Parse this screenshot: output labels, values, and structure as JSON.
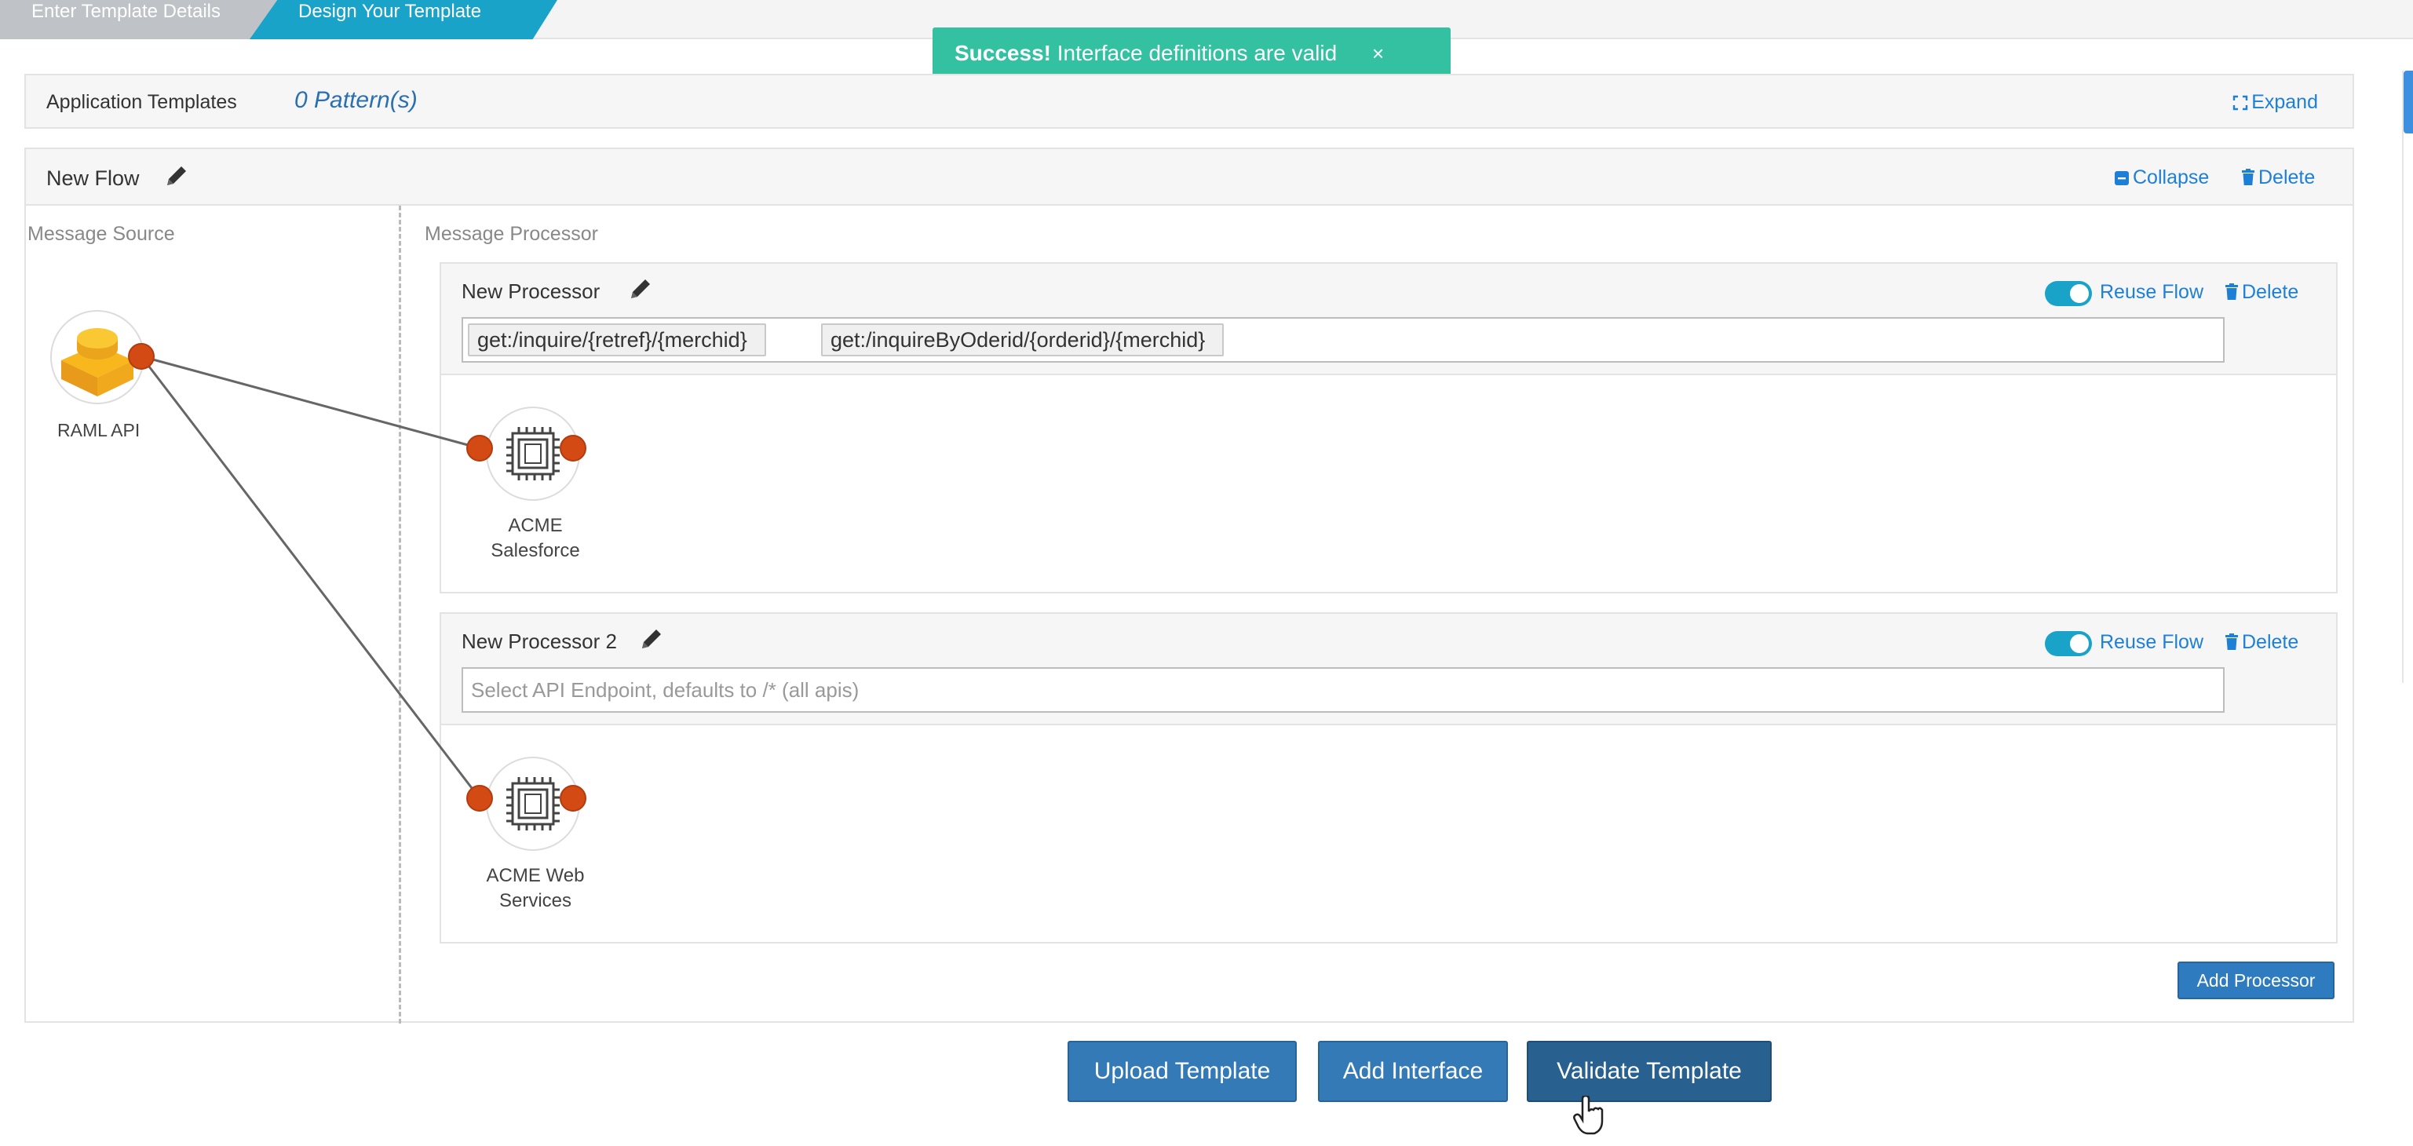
{
  "wizard": {
    "steps": [
      "Enter Template Details",
      "Design Your Template"
    ]
  },
  "toast": {
    "strong": "Success!",
    "message": " Interface definitions are valid",
    "close": "×",
    "color": "#33c1a2"
  },
  "app_templates": {
    "label": "Application Templates",
    "patterns": "0 Pattern(s)",
    "expand": "Expand"
  },
  "flow": {
    "title": "New Flow",
    "collapse": "Collapse",
    "delete": "Delete",
    "source_label": "Message Source",
    "processor_label": "Message Processor",
    "source_node": {
      "name": "RAML API",
      "icon": "raml-api-icon"
    }
  },
  "processors": [
    {
      "title": "New Processor",
      "reuse_flow": "Reuse Flow",
      "reuse_enabled": true,
      "delete": "Delete",
      "endpoints": [
        "get:/inquire/{retref}/{merchid}",
        "get:/inquireByOderid/{orderid}/{merchid}"
      ],
      "node_name": "ACME Salesforce",
      "node_icon": "cpu-icon"
    },
    {
      "title": "New Processor 2",
      "reuse_flow": "Reuse Flow",
      "reuse_enabled": true,
      "delete": "Delete",
      "endpoint_placeholder": "Select API Endpoint, defaults to /* (all apis)",
      "node_name": "ACME Web Services",
      "node_icon": "cpu-icon"
    }
  ],
  "add_processor": "Add Processor",
  "buttons": {
    "upload": "Upload Template",
    "add_interface": "Add Interface",
    "validate": "Validate Template"
  },
  "colors": {
    "accent": "#1aa3c9",
    "primary_button": "#337ab7",
    "link": "#1d7fd6",
    "connector": "#d34a14"
  }
}
